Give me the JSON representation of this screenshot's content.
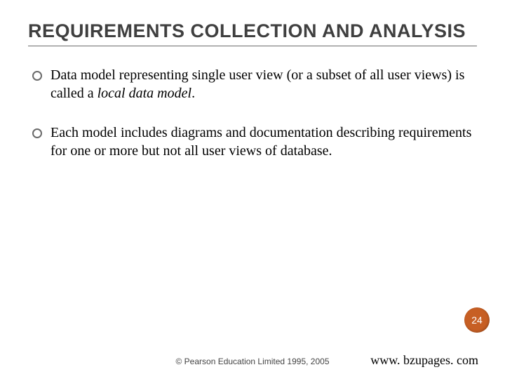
{
  "title": "REQUIREMENTS COLLECTION AND ANALYSIS",
  "bullets": [
    {
      "pre": "Data model representing single user view (or a subset of all user views) is called a ",
      "em": "local data model",
      "post": "."
    },
    {
      "pre": "Each model includes diagrams and documentation describing requirements for one or more but not all user views of  database.",
      "em": "",
      "post": ""
    }
  ],
  "page_number": "24",
  "copyright": "© Pearson Education Limited 1995, 2005",
  "site": "www. bzupages. com"
}
